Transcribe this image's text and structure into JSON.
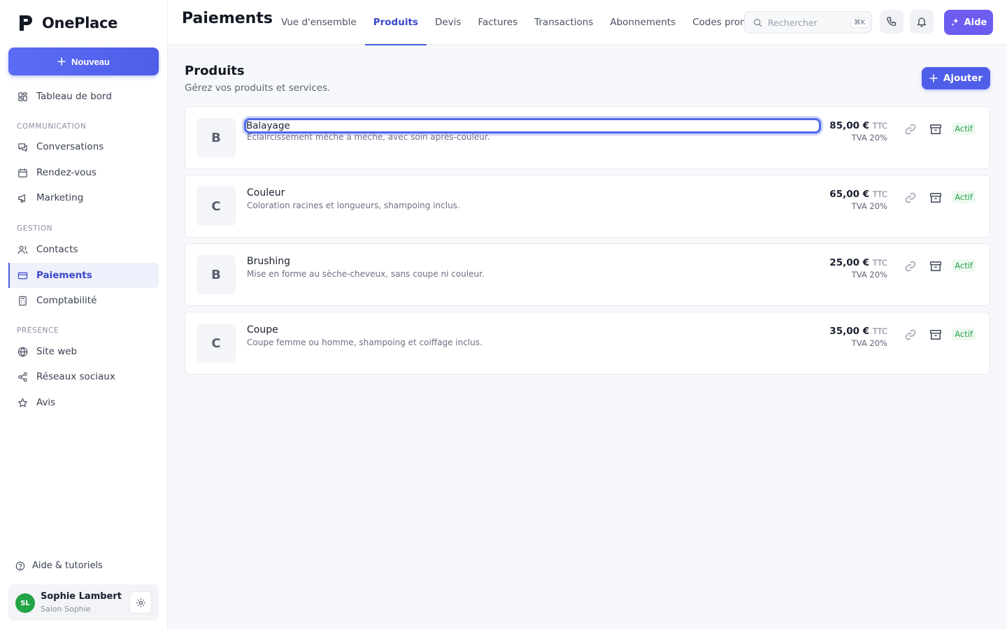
{
  "app": {
    "name": "OnePlace"
  },
  "sidebar": {
    "new_button": "Nouveau",
    "dashboard": "Tableau de bord",
    "sections": {
      "communication": "COMMUNICATION",
      "gestion": "GESTION",
      "presence": "PRÉSENCE"
    },
    "items": {
      "conversations": "Conversations",
      "rendezvous": "Rendez-vous",
      "marketing": "Marketing",
      "contacts": "Contacts",
      "paiements": "Paiements",
      "comptabilite": "Comptabilité",
      "siteweb": "Site web",
      "reseaux": "Réseaux sociaux",
      "avis": "Avis"
    },
    "help": "Aide & tutoriels",
    "user": {
      "initials": "SL",
      "name": "Sophie Lambert",
      "business": "Salon Sophie"
    }
  },
  "header": {
    "title": "Paiements",
    "tabs": [
      "Vue d'ensemble",
      "Produits",
      "Devis",
      "Factures",
      "Transactions",
      "Abonnements",
      "Codes promo"
    ],
    "active_tab": "Produits",
    "search_placeholder": "Rechercher",
    "search_shortcut": "⌘K",
    "help_button": "Aide"
  },
  "main": {
    "title": "Produits",
    "subtitle": "Gérez vos produits et services.",
    "add_button": "Ajouter",
    "products": [
      {
        "letter": "B",
        "name": "Balayage",
        "description": "Éclaircissement mèche à mèche, avec soin après-couleur.",
        "price": "85,00 €",
        "price_suffix": "TTC",
        "vat": "TVA 20%",
        "status": "Actif",
        "editing": true
      },
      {
        "letter": "C",
        "name": "Couleur",
        "description": "Coloration racines et longueurs, shampoing inclus.",
        "price": "65,00 €",
        "price_suffix": "TTC",
        "vat": "TVA 20%",
        "status": "Actif",
        "editing": false
      },
      {
        "letter": "B",
        "name": "Brushing",
        "description": "Mise en forme au sèche-cheveux, sans coupe ni couleur.",
        "price": "25,00 €",
        "price_suffix": "TTC",
        "vat": "TVA 20%",
        "status": "Actif",
        "editing": false
      },
      {
        "letter": "C",
        "name": "Coupe",
        "description": "Coupe femme ou homme, shampoing et coiffage inclus.",
        "price": "35,00 €",
        "price_suffix": "TTC",
        "vat": "TVA 20%",
        "status": "Actif",
        "editing": false
      }
    ]
  },
  "colors": {
    "accent": "#4f5ee8",
    "help": "#6d5cf0",
    "active_badge": "#23a34a",
    "avatar": "#22a447"
  }
}
